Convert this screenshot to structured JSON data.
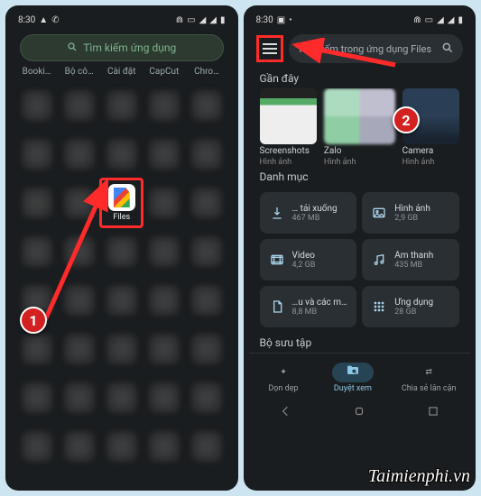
{
  "status_time": "8:30",
  "drawer": {
    "search_placeholder": "Tìm kiếm ứng dụng",
    "tabs": [
      "Booki…",
      "Bộ cô…",
      "Cài đặt",
      "CapCut",
      "Chro…"
    ],
    "files_label": "Files"
  },
  "files_app": {
    "search_placeholder": "Tìm kiếm trong ứng dụng Files",
    "recent_title": "Gần đây",
    "recent": [
      {
        "name": "Screenshots",
        "sub": "Hình ảnh"
      },
      {
        "name": "Zalo",
        "sub": "Hình ảnh"
      },
      {
        "name": "Camera",
        "sub": "Hình ảnh"
      }
    ],
    "categories_title": "Danh mục",
    "categories": [
      {
        "name": "… tải xuống",
        "size": "467 MB",
        "icon": "download"
      },
      {
        "name": "Hình ảnh",
        "size": "2,9 GB",
        "icon": "image"
      },
      {
        "name": "Video",
        "size": "4,2 GB",
        "icon": "video"
      },
      {
        "name": "Âm thanh",
        "size": "435 MB",
        "icon": "audio"
      },
      {
        "name": "…u và các m…",
        "size": "8,8 MB",
        "icon": "doc"
      },
      {
        "name": "Ứng dụng",
        "size": "28 GB",
        "icon": "apps"
      }
    ],
    "collections_title": "Bộ sưu tập",
    "nav": [
      {
        "label": "Dọn dẹp"
      },
      {
        "label": "Duyệt xem"
      },
      {
        "label": "Chia sẻ lân cận"
      }
    ]
  },
  "callouts": {
    "one": "1",
    "two": "2"
  },
  "watermark": "Taimienphi.vn"
}
